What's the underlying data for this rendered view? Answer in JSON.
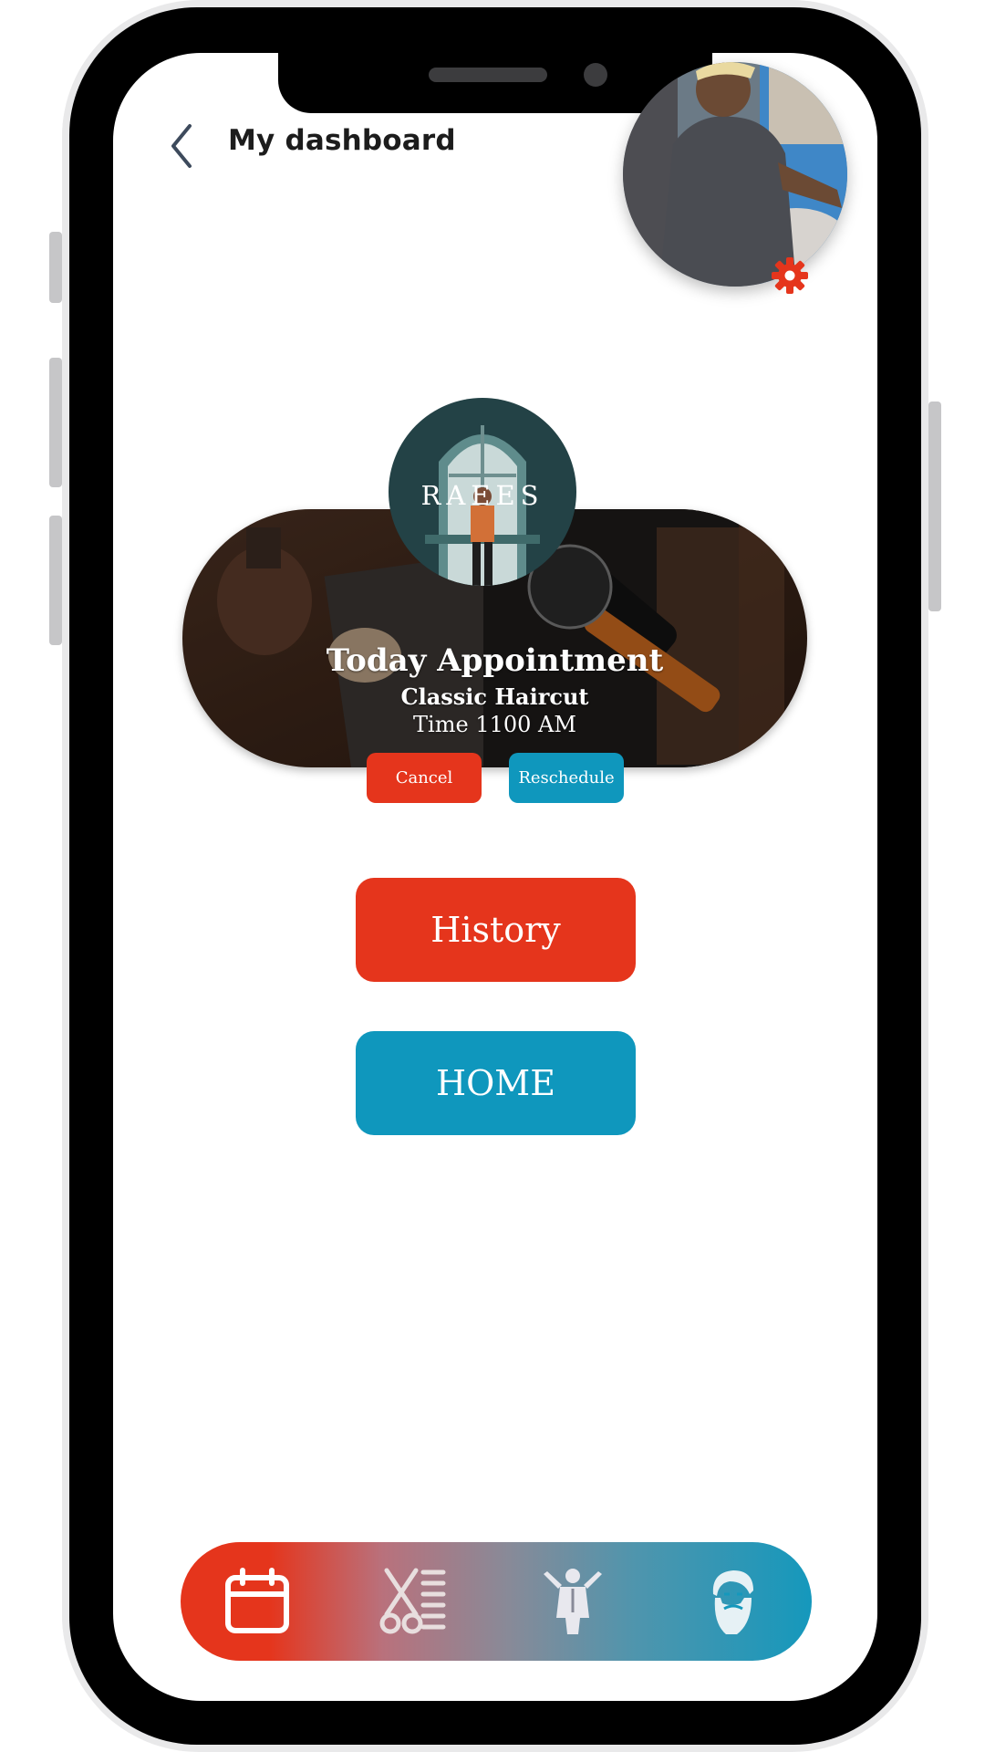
{
  "header": {
    "title": "My dashboard"
  },
  "appointment": {
    "barber_name": "RAEES",
    "heading": "Today Appointment",
    "service": "Classic Haircut",
    "time": "Time 1100 AM",
    "cancel_label": "Cancel",
    "reschedule_label": "Reschedule"
  },
  "actions": {
    "history_label": "History",
    "home_label": "HOME"
  },
  "bottom_nav": {
    "items": [
      "calendar-icon",
      "barber-tools-icon",
      "barber-stylist-icon",
      "bearded-man-icon"
    ]
  },
  "colors": {
    "accent_red": "#e5351c",
    "accent_teal": "#0f97bd"
  }
}
